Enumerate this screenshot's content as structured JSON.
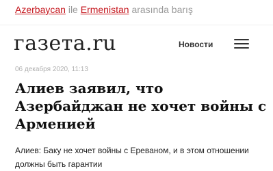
{
  "banner": {
    "word1": "Azerbaycan",
    "word2": "ile",
    "word3": "Ermenistan",
    "word4": "arasında barış"
  },
  "header": {
    "logo": "газета.ru",
    "nav_label": "Новости",
    "menu_icon": "hamburger-menu-icon"
  },
  "article": {
    "date": "06 декабря 2020, 11:13",
    "headline": "Алиев заявил, что Азербайджан не хочет войны с Арменией",
    "lead": "Алиев: Баку не хочет войны с Ереваном, и в этом отношении должны быть гарантии"
  },
  "colors": {
    "link": "#c5151c",
    "text": "#111111"
  }
}
